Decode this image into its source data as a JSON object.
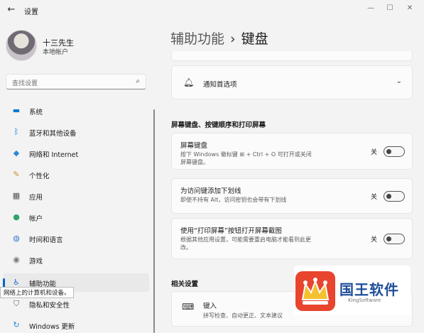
{
  "window": {
    "title": "设置",
    "back_icon": "back-arrow-icon",
    "controls": [
      "minimize",
      "maximize",
      "close"
    ]
  },
  "user": {
    "name": "十三先生",
    "account_type": "本地帐户"
  },
  "search": {
    "placeholder": "查找设置"
  },
  "sidebar": {
    "items": [
      {
        "label": "系统",
        "icon": "monitor-icon",
        "color": "#0078d4"
      },
      {
        "label": "蓝牙和其他设备",
        "icon": "bluetooth-icon",
        "color": "#0078d4"
      },
      {
        "label": "网络和 Internet",
        "icon": "wifi-icon",
        "color": "#2b88d8"
      },
      {
        "label": "个性化",
        "icon": "brush-icon",
        "color": "#d08a2c"
      },
      {
        "label": "应用",
        "icon": "apps-icon",
        "color": "#555555"
      },
      {
        "label": "帐户",
        "icon": "person-icon",
        "color": "#2fa36b"
      },
      {
        "label": "时间和语言",
        "icon": "globe-clock-icon",
        "color": "#3a7bd5"
      },
      {
        "label": "游戏",
        "icon": "game-icon",
        "color": "#777777"
      },
      {
        "label": "辅助功能",
        "icon": "accessibility-icon",
        "color": "#1e6fd9",
        "active": true
      },
      {
        "label": "隐私和安全性",
        "icon": "shield-icon",
        "color": "#666666"
      },
      {
        "label": "Windows 更新",
        "icon": "update-icon",
        "color": "#2b88d8"
      }
    ],
    "tooltip": "网络上的计算机和设备。"
  },
  "main": {
    "breadcrumb_parent": "辅助功能",
    "breadcrumb_separator": "›",
    "page_title": "键盘",
    "notify": {
      "label": "通知首选项"
    },
    "section1_title": "屏幕键盘、按键顺序和打印屏幕",
    "options": [
      {
        "title": "屏幕键盘",
        "desc": "按下 Windows 徽标键 ⊞ + Ctrl + O 可打开或关闭屏幕键盘。",
        "state": "关",
        "enabled": false
      },
      {
        "title": "为访问键添加下划线",
        "desc": "即使不持有 Alt，访问密钥也会带有下划线",
        "state": "关",
        "enabled": false
      },
      {
        "title": "使用“打印屏幕”按钮打开屏幕截图",
        "desc": "根据其他应用设置，可能需要重启电脑才能看到此更改。",
        "state": "关",
        "enabled": false
      }
    ],
    "section2_title": "相关设置",
    "typing": {
      "title": "键入",
      "desc": "拼写检查、自动更正、文本建议"
    }
  },
  "watermark": {
    "name": "国王软件",
    "sub": "KingSoftware"
  },
  "colors": {
    "accent": "#0067c0",
    "background": "#f3f3f3",
    "card": "#fbfbfb",
    "watermark_red": "#e8442e",
    "watermark_blue": "#1f4e9b"
  }
}
